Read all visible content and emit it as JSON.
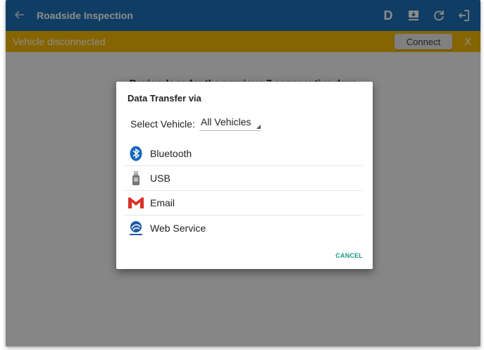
{
  "header": {
    "back_icon": "arrow-left-icon",
    "title": "Roadside Inspection",
    "icons": {
      "d_label": "D",
      "transfer_icon": "data-transfer-icon",
      "refresh_icon": "refresh-icon",
      "logout_icon": "logout-icon"
    },
    "bar_color": "#1e6fb5"
  },
  "status": {
    "text": "Vehicle disconnected",
    "connect_label": "Connect",
    "dismiss_label": "X",
    "bar_color": "#f5b800"
  },
  "main": {
    "review_text": "Review logs for the previous 7 consecutive days"
  },
  "dialog": {
    "title": "Data Transfer via",
    "vehicle_label": "Select Vehicle:",
    "vehicle_value": "All Vehicles",
    "options": [
      {
        "label": "Bluetooth",
        "icon": "bluetooth-icon"
      },
      {
        "label": "USB",
        "icon": "usb-drive-icon"
      },
      {
        "label": "Email",
        "icon": "gmail-icon"
      },
      {
        "label": "Web Service",
        "icon": "fmcsa-icon"
      }
    ],
    "cancel_label": "CANCEL",
    "cancel_color": "#1a9a8a"
  }
}
